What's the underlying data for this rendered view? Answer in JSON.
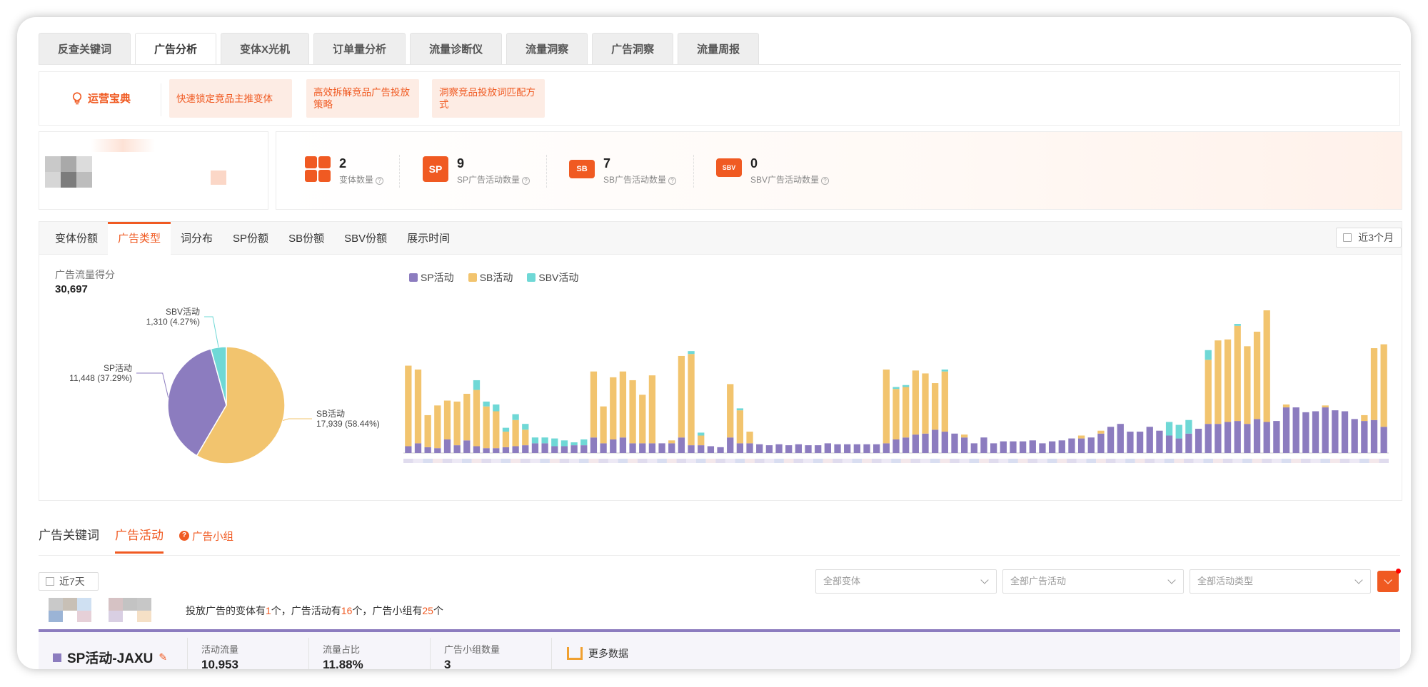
{
  "top_tabs": [
    "反查关键词",
    "广告分析",
    "变体X光机",
    "订单量分析",
    "流量诊断仪",
    "流量洞察",
    "广告洞察",
    "流量周报"
  ],
  "active_top_tab": 1,
  "tips": {
    "brand": "运营宝典",
    "items": [
      "快速锁定竞品主推变体",
      "高效拆解竞品广告投放策略",
      "洞察竞品投放词匹配方式"
    ]
  },
  "stats": [
    {
      "icon": "grid",
      "value": "2",
      "label": "变体数量"
    },
    {
      "icon": "SP",
      "value": "9",
      "label": "SP广告活动数量"
    },
    {
      "icon": "SB",
      "value": "7",
      "label": "SB广告活动数量"
    },
    {
      "icon": "SBV",
      "value": "0",
      "label": "SBV广告活动数量"
    }
  ],
  "sub_tabs": [
    "变体份额",
    "广告类型",
    "词分布",
    "SP份额",
    "SB份额",
    "SBV份额",
    "展示时间"
  ],
  "active_sub_tab": 1,
  "date_range": "近3个月",
  "score": {
    "label": "广告流量得分",
    "value": "30,697"
  },
  "colors": {
    "sp": "#8c7cbf",
    "sb": "#f2c46e",
    "sbv": "#6fd8d6",
    "accent": "#f05a22"
  },
  "pie": [
    {
      "name": "SB活动",
      "value_text": "17,939 (58.44%)",
      "value": 17939,
      "pct": 58.44
    },
    {
      "name": "SP活动",
      "value_text": "11,448 (37.29%)",
      "value": 11448,
      "pct": 37.29
    },
    {
      "name": "SBV活动",
      "value_text": "1,310 (4.27%)",
      "value": 1310,
      "pct": 4.27
    }
  ],
  "chart_data": {
    "type": "bar",
    "stacked": true,
    "x_labels_visible": false,
    "y_axis_visible": false,
    "legend": [
      "SP活动",
      "SB活动",
      "SBV活动"
    ],
    "series": [
      {
        "name": "SP活动",
        "values": [
          7,
          10,
          6,
          5,
          14,
          8,
          13,
          7,
          5,
          5,
          6,
          7,
          8,
          10,
          10,
          7,
          7,
          8,
          8,
          16,
          10,
          14,
          16,
          10,
          10,
          10,
          10,
          10,
          16,
          8,
          8,
          7,
          6,
          16,
          10,
          10,
          9,
          8,
          9,
          8,
          9,
          8,
          8,
          10,
          9,
          9,
          9,
          9,
          9,
          10,
          14,
          16,
          19,
          20,
          24,
          22,
          20,
          16,
          10,
          16,
          10,
          12,
          12,
          12,
          13,
          10,
          12,
          13,
          15,
          15,
          16,
          20,
          27,
          30,
          22,
          22,
          27,
          23,
          18,
          15,
          20,
          25,
          30,
          30,
          32,
          33,
          30,
          35,
          32,
          33,
          47,
          47,
          42,
          43,
          47,
          44,
          43,
          35,
          33,
          34,
          27
        ]
      },
      {
        "name": "SB活动",
        "values": [
          83,
          76,
          33,
          44,
          40,
          45,
          48,
          58,
          43,
          38,
          16,
          27,
          16,
          0,
          0,
          0,
          0,
          0,
          0,
          68,
          38,
          64,
          68,
          65,
          50,
          70,
          0,
          3,
          84,
          94,
          10,
          0,
          0,
          55,
          34,
          12,
          0,
          0,
          0,
          0,
          0,
          0,
          0,
          0,
          0,
          0,
          0,
          0,
          0,
          76,
          52,
          52,
          66,
          62,
          48,
          62,
          0,
          3,
          0,
          0,
          0,
          0,
          0,
          0,
          0,
          0,
          0,
          0,
          0,
          3,
          0,
          3,
          0,
          0,
          0,
          0,
          0,
          0,
          0,
          0,
          0,
          0,
          66,
          86,
          85,
          98,
          80,
          90,
          115,
          0,
          3,
          0,
          0,
          0,
          2,
          0,
          0,
          0,
          6,
          74,
          85
        ]
      },
      {
        "name": "SBV活动",
        "values": [
          0,
          0,
          0,
          0,
          0,
          0,
          0,
          10,
          5,
          7,
          4,
          6,
          6,
          6,
          6,
          8,
          6,
          3,
          6,
          0,
          0,
          0,
          0,
          0,
          0,
          0,
          0,
          0,
          0,
          3,
          3,
          0,
          0,
          0,
          2,
          0,
          0,
          0,
          0,
          0,
          0,
          0,
          0,
          0,
          0,
          0,
          0,
          0,
          0,
          0,
          2,
          2,
          0,
          0,
          0,
          2,
          0,
          0,
          0,
          0,
          0,
          0,
          0,
          0,
          0,
          0,
          0,
          0,
          0,
          0,
          0,
          0,
          0,
          0,
          0,
          0,
          0,
          0,
          14,
          14,
          14,
          0,
          10,
          0,
          0,
          2,
          0,
          0,
          0,
          0,
          0,
          0,
          0,
          0,
          0,
          0,
          0,
          0,
          0,
          0,
          0
        ]
      }
    ]
  },
  "section2": {
    "tabs": [
      "广告关键词",
      "广告活动",
      "广告小组"
    ],
    "active": 1,
    "date": "近7天",
    "filters": [
      "全部变体",
      "全部广告活动",
      "全部活动类型"
    ],
    "summary": {
      "p1": "投放广告的变体有",
      "n1": "1",
      "p2": "个，广告活动有",
      "n2": "16",
      "p3": "个，广告小组有",
      "n3": "25",
      "p4": "个"
    }
  },
  "campaign": {
    "title": "SP活动-JAXU",
    "cols": [
      {
        "label": "活动流量",
        "value": "10,953"
      },
      {
        "label": "流量占比",
        "value": "11.88%"
      },
      {
        "label": "广告小组数量",
        "value": "3"
      }
    ],
    "more": "更多数据"
  }
}
